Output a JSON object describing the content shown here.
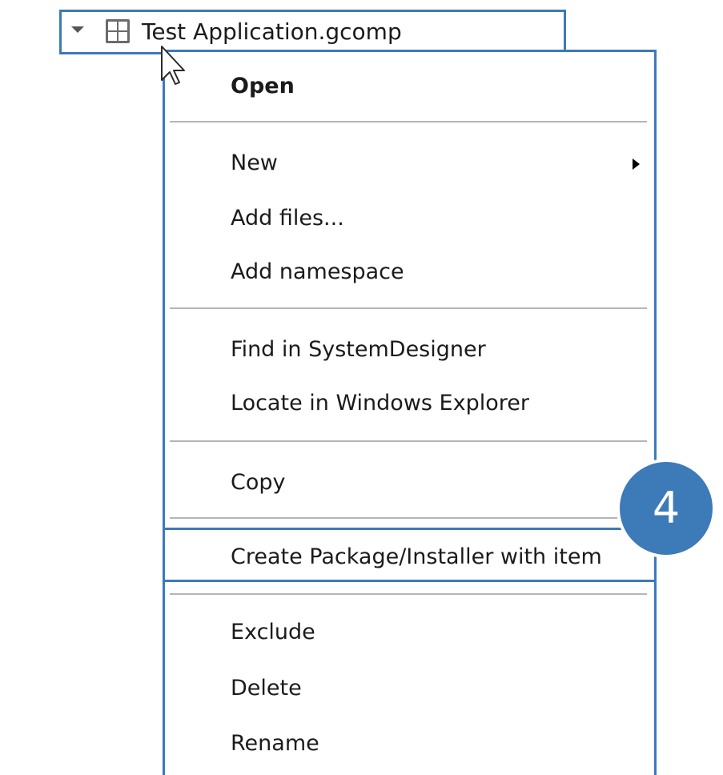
{
  "tree": {
    "item_label": "Test Application.gcomp",
    "expander_icon": "chevron-down-icon",
    "item_icon": "component-grid-icon"
  },
  "menu": {
    "groups": [
      [
        "Open"
      ],
      [
        "New",
        "Add files...",
        "Add namespace"
      ],
      [
        "Find in SystemDesigner",
        "Locate in Windows Explorer"
      ],
      [
        "Copy"
      ],
      [
        "Create Package/Installer with item"
      ],
      [
        "Exclude",
        "Delete",
        "Rename"
      ]
    ],
    "open": "Open",
    "new": "New",
    "add_files": "Add files...",
    "add_namespace": "Add namespace",
    "find_in_systemdesigner": "Find in SystemDesigner",
    "locate_in_explorer": "Locate in Windows Explorer",
    "copy": "Copy",
    "create_package": "Create Package/Installer with item",
    "exclude": "Exclude",
    "delete": "Delete",
    "rename": "Rename"
  },
  "callout": {
    "number": "4"
  },
  "colors": {
    "accent": "#3d7ab8",
    "separator": "#b5b5b5",
    "icon_gray": "#6b6b6b"
  }
}
